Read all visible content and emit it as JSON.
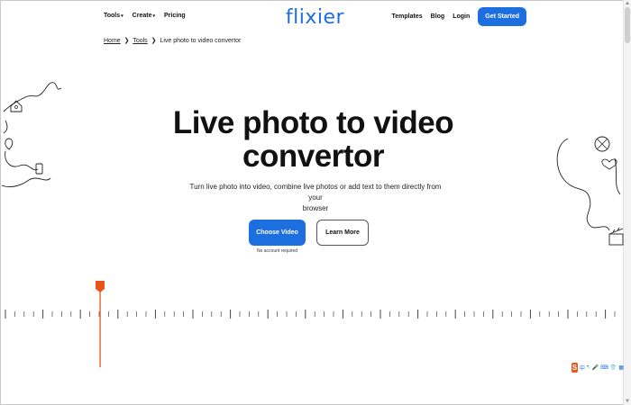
{
  "nav": {
    "tools_label": "Tools",
    "create_label": "Create",
    "pricing_label": "Pricing",
    "logo_text": "flixier",
    "templates_label": "Templates",
    "blog_label": "Blog",
    "login_label": "Login",
    "get_started_label": "Get Started"
  },
  "breadcrumb": {
    "home": "Home",
    "tools": "Tools",
    "current": "Live photo to video convertor",
    "separator": "❯"
  },
  "hero": {
    "title_line1": "Live photo to video",
    "title_line2": "convertor",
    "subtitle_line1": "Turn live photo into video, combine live photos or add text to them directly from your",
    "subtitle_line2": "browser",
    "choose_label": "Choose Video",
    "learn_label": "Learn More",
    "note": "No account required"
  },
  "ime": {
    "logo": "S",
    "mode": "中"
  },
  "colors": {
    "brand": "#1d6fe0",
    "playhead": "#e8561c",
    "text": "#111111"
  }
}
